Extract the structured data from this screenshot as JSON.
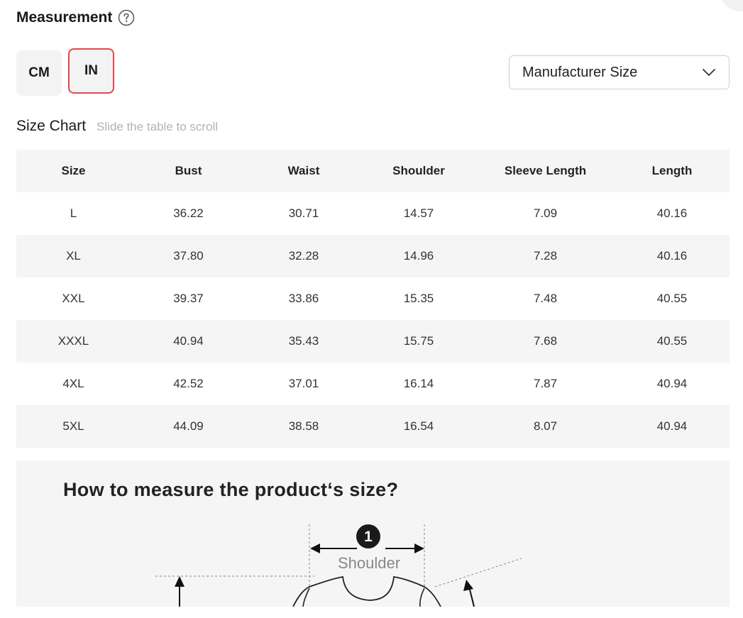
{
  "header": {
    "title": "Measurement",
    "help_icon": "question-circle-icon"
  },
  "units": {
    "options": [
      "CM",
      "IN"
    ],
    "selected": "IN"
  },
  "size_select": {
    "value": "Manufacturer Size",
    "icon": "chevron-down-icon"
  },
  "size_chart": {
    "title": "Size Chart",
    "hint": "Slide the table to scroll",
    "columns": [
      "Size",
      "Bust",
      "Waist",
      "Shoulder",
      "Sleeve Length",
      "Length"
    ],
    "rows": [
      [
        "L",
        "36.22",
        "30.71",
        "14.57",
        "7.09",
        "40.16"
      ],
      [
        "XL",
        "37.80",
        "32.28",
        "14.96",
        "7.28",
        "40.16"
      ],
      [
        "XXL",
        "39.37",
        "33.86",
        "15.35",
        "7.48",
        "40.55"
      ],
      [
        "XXXL",
        "40.94",
        "35.43",
        "15.75",
        "7.68",
        "40.55"
      ],
      [
        "4XL",
        "42.52",
        "37.01",
        "16.14",
        "7.87",
        "40.94"
      ],
      [
        "5XL",
        "44.09",
        "38.58",
        "16.54",
        "8.07",
        "40.94"
      ]
    ]
  },
  "guide": {
    "title": "How to measure the product‘s size?",
    "marker_number": "1",
    "marker_label": "Shoulder"
  },
  "colors": {
    "selected_border": "#e5484d",
    "row_shade": "#f5f5f5"
  }
}
